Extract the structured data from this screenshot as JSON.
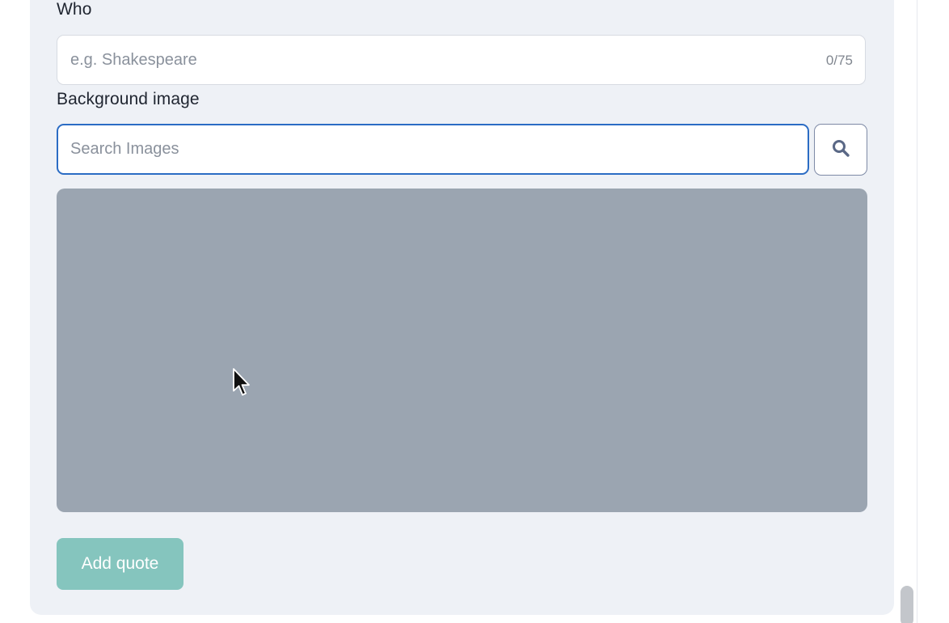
{
  "form": {
    "who": {
      "label": "Who",
      "value": "",
      "placeholder": "e.g. Shakespeare",
      "counter": "0/75"
    },
    "background_image": {
      "label": "Background image",
      "search": {
        "value": "",
        "placeholder": "Search Images"
      },
      "search_button_icon": "search-icon"
    },
    "submit_label": "Add quote"
  },
  "colors": {
    "card_background": "#eef1f6",
    "focus_border": "#2b6cc4",
    "image_placeholder": "#9ba5b1",
    "submit_button": "#85c5be",
    "search_icon": "#5a6886"
  }
}
